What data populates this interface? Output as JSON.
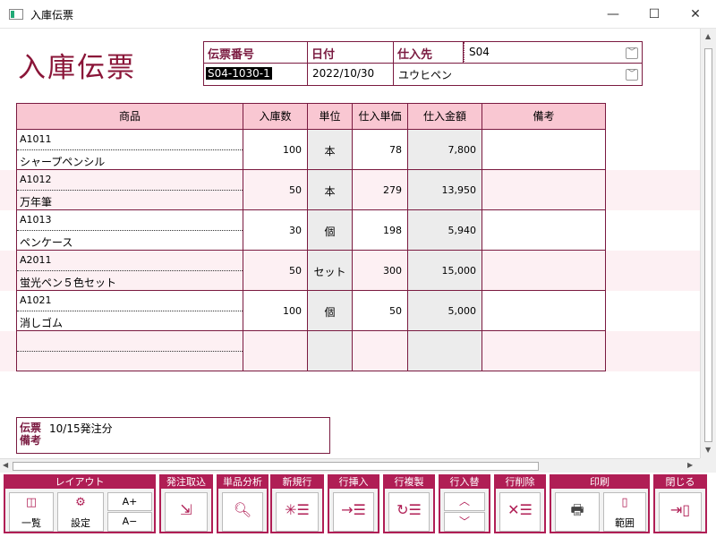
{
  "window": {
    "title": "入庫伝票",
    "minimize": "—",
    "maximize": "☐",
    "close": "✕"
  },
  "page_title": "入庫伝票",
  "header": {
    "slip_no_label": "伝票番号",
    "slip_no": "S04-1030-1",
    "date_label": "日付",
    "date": "2022/10/30",
    "supplier_label": "仕入先",
    "supplier_code": "S04",
    "supplier_name": "ユウヒペン"
  },
  "grid": {
    "columns": [
      "商品",
      "入庫数",
      "単位",
      "仕入単価",
      "仕入金額",
      "備考"
    ],
    "rows": [
      {
        "code": "A1011",
        "name": "シャープペンシル",
        "qty": "100",
        "unit": "本",
        "price": "78",
        "amount": "7,800",
        "note": ""
      },
      {
        "code": "A1012",
        "name": "万年筆",
        "qty": "50",
        "unit": "本",
        "price": "279",
        "amount": "13,950",
        "note": ""
      },
      {
        "code": "A1013",
        "name": "ペンケース",
        "qty": "30",
        "unit": "個",
        "price": "198",
        "amount": "5,940",
        "note": ""
      },
      {
        "code": "A2011",
        "name": "蛍光ペン５色セット",
        "qty": "50",
        "unit": "セット",
        "price": "300",
        "amount": "15,000",
        "note": ""
      },
      {
        "code": "A1021",
        "name": "消しゴム",
        "qty": "100",
        "unit": "個",
        "price": "50",
        "amount": "5,000",
        "note": ""
      },
      {
        "code": "",
        "name": "",
        "qty": "",
        "unit": "",
        "price": "",
        "amount": "",
        "note": ""
      }
    ]
  },
  "memo": {
    "label_1": "伝票",
    "label_2": "備考",
    "text": "10/15発注分"
  },
  "toolbar": {
    "layout": {
      "title": "レイアウト",
      "list": "一覧",
      "settings": "設定",
      "font_up": "A+",
      "font_down": "A−"
    },
    "order_import": {
      "title": "発注取込"
    },
    "item_analysis": {
      "title": "単品分析"
    },
    "new_row": {
      "title": "新規行"
    },
    "insert_row": {
      "title": "行挿入"
    },
    "copy_row": {
      "title": "行複製"
    },
    "swap_row": {
      "title": "行入替"
    },
    "delete_row": {
      "title": "行削除"
    },
    "print": {
      "title": "印刷",
      "range": "範囲"
    },
    "close": {
      "title": "閉じる"
    }
  },
  "colors": {
    "accent": "#b01e55",
    "title": "#8a1538",
    "header_bg": "#f9c7d2",
    "band_bg": "#fdf0f3"
  }
}
